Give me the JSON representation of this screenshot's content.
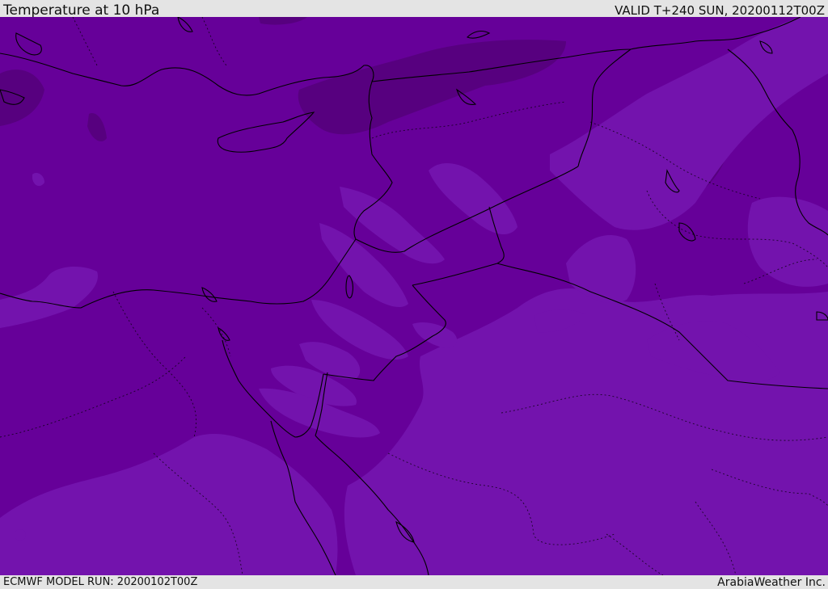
{
  "header": {
    "title": "Temperature at 10 hPa",
    "valid": "VALID T+240 SUN, 20200112T00Z"
  },
  "footer": {
    "model_run": "ECMWF MODEL RUN: 20200102T00Z",
    "credit": "ArabiaWeather Inc."
  },
  "map": {
    "variable": "temperature",
    "level": "10 hPa",
    "region": "Eastern Mediterranean / Middle East",
    "colors": {
      "base": "#660099",
      "dark": "#570080",
      "light": "#7313ad",
      "coastline": "#000000"
    }
  }
}
